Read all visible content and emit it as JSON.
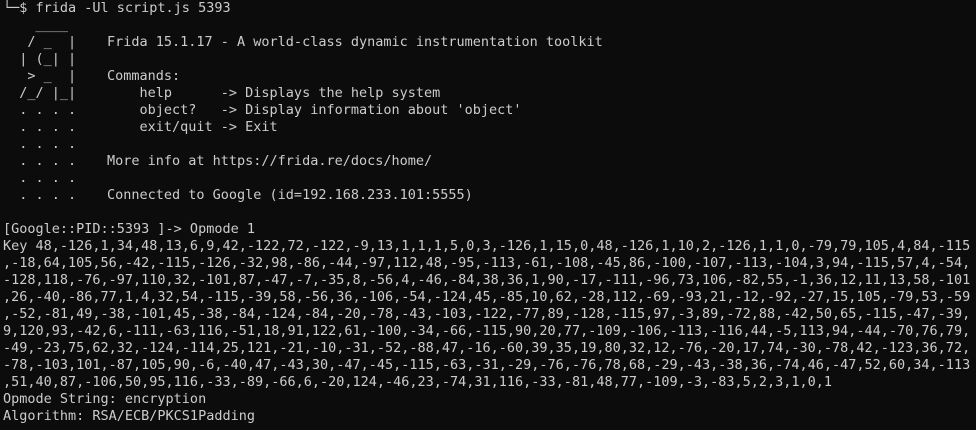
{
  "prompt": {
    "line": "└─$ frida -Ul script.js 5393"
  },
  "banner": {
    "rows": [
      {
        "logo": "    ____",
        "text": ""
      },
      {
        "logo": "   / _  |",
        "text": "Frida 15.1.17 - A world-class dynamic instrumentation toolkit"
      },
      {
        "logo": "  | (_| |",
        "text": ""
      },
      {
        "logo": "   > _  |",
        "text": "Commands:"
      },
      {
        "logo": "  /_/ |_|",
        "text": "    help      -> Displays the help system"
      },
      {
        "logo": "  . . . .",
        "text": "    object?   -> Display information about 'object'"
      },
      {
        "logo": "  . . . .",
        "text": "    exit/quit -> Exit"
      },
      {
        "logo": "  . . . .",
        "text": ""
      },
      {
        "logo": "  . . . .",
        "text": "More info at https://frida.re/docs/home/"
      },
      {
        "logo": "  . . . .",
        "text": ""
      },
      {
        "logo": "  . . . .",
        "text": "Connected to Google (id=192.168.233.101:5555)"
      }
    ]
  },
  "output": {
    "lines": [
      "[Google::PID::5393 ]-> Opmode 1",
      "Key 48,-126,1,34,48,13,6,9,42,-122,72,-122,-9,13,1,1,1,5,0,3,-126,1,15,0,48,-126,1,10,2,-126,1,1,0,-79,79,105,4,84,-115",
      ",-18,64,105,56,-42,-115,-126,-32,98,-86,-44,-97,112,48,-95,-113,-61,-108,-45,86,-100,-107,-113,-104,3,94,-115,57,4,-54,",
      "-128,118,-76,-97,110,32,-101,87,-47,-7,-35,8,-56,4,-46,-84,38,36,1,90,-17,-111,-96,73,106,-82,55,-1,36,12,11,13,58,-101",
      ",26,-40,-86,77,1,4,32,54,-115,-39,58,-56,36,-106,-54,-124,45,-85,10,62,-28,112,-69,-93,21,-12,-92,-27,15,105,-79,53,-59",
      ",-52,-81,49,-38,-101,45,-38,-84,-124,-84,-20,-78,-43,-103,-122,-77,89,-128,-115,97,-3,89,-72,88,-42,50,65,-115,-47,-39,",
      "9,120,93,-42,6,-111,-63,116,-51,18,91,122,61,-100,-34,-66,-115,90,20,77,-109,-106,-113,-116,44,-5,113,94,-44,-70,76,79,",
      "-49,-23,75,62,32,-124,-114,25,121,-21,-10,-31,-52,-88,47,-16,-60,39,35,19,80,32,12,-76,-20,17,74,-30,-78,42,-123,36,72,",
      "-78,-103,101,-87,105,90,-6,-40,47,-43,30,-47,-45,-115,-63,-31,-29,-76,-76,78,68,-29,-43,-38,36,-74,46,-47,52,60,34,-113",
      ",51,40,87,-106,50,95,116,-33,-89,-66,6,-20,124,-46,23,-74,31,116,-33,-81,48,77,-109,-3,-83,5,2,3,1,0,1",
      "Opmode String: encryption",
      "Algorithm: RSA/ECB/PKCS1Padding"
    ]
  }
}
